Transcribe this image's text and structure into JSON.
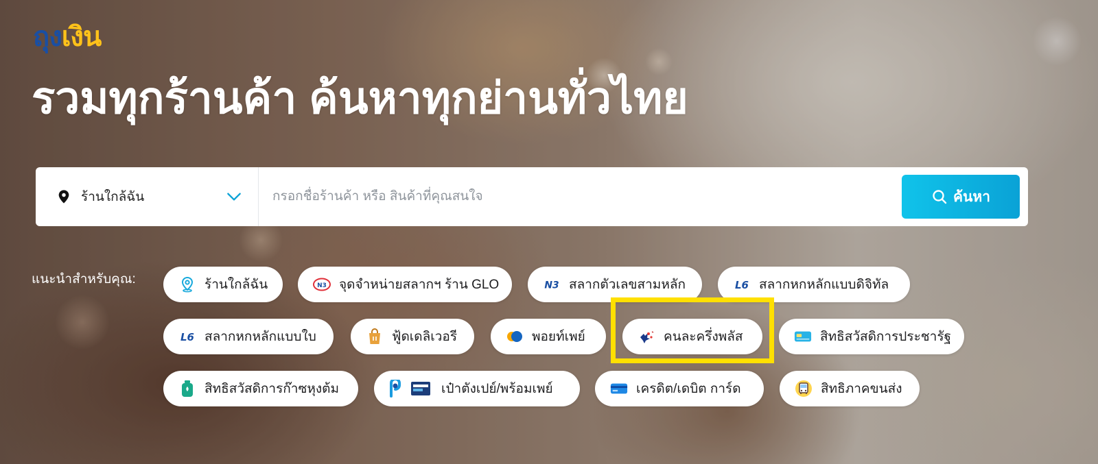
{
  "brand": {
    "logo_part1": "ถุง",
    "logo_part2": "เงิน"
  },
  "hero": {
    "headline": "รวมทุกร้านค้า ค้นหาทุกย่านทั่วไทย"
  },
  "search": {
    "location_label": "ร้านใกล้ฉัน",
    "placeholder": "กรอกชื่อร้านค้า หรือ สินค้าที่คุณสนใจ",
    "button_label": "ค้นหา"
  },
  "recommendations": {
    "label": "แนะนำสำหรับคุณ:",
    "chips": [
      {
        "label": "ร้านใกล้ฉัน",
        "icon": "map-pin-icon"
      },
      {
        "label": "จุดจำหน่ายสลากฯ ร้าน GLO",
        "icon": "glo-lottery-icon"
      },
      {
        "label": "สลากตัวเลขสามหลัก",
        "icon": "n3-lottery-icon"
      },
      {
        "label": "สลากหกหลักแบบดิจิทัล",
        "icon": "l6-digital-icon"
      },
      {
        "label": "สลากหกหลักแบบใบ",
        "icon": "l6-paper-icon"
      },
      {
        "label": "ฟู้ดเดลิเวอรี",
        "icon": "food-bag-icon"
      },
      {
        "label": "พอยท์เพย์",
        "icon": "pointpay-icon"
      },
      {
        "label": "คนละครึ่งพลัส",
        "icon": "half-half-plus-icon"
      },
      {
        "label": "สิทธิสวัสดิการประชารัฐ",
        "icon": "welfare-card-icon"
      },
      {
        "label": "สิทธิสวัสดิการก๊าซหุงต้ม",
        "icon": "gas-tank-icon"
      },
      {
        "label": "เป๋าตังเปย์/พร้อมเพย์",
        "icon": "paotang-promptpay-icon"
      },
      {
        "label": "เครดิต/เดบิต การ์ด",
        "icon": "credit-card-icon"
      },
      {
        "label": "สิทธิภาคขนส่ง",
        "icon": "bus-icon"
      }
    ]
  },
  "colors": {
    "accent": "#0aa2d6",
    "logo_blue": "#1a4fa3",
    "logo_yellow": "#ffc21a",
    "highlight": "#ffe000"
  }
}
